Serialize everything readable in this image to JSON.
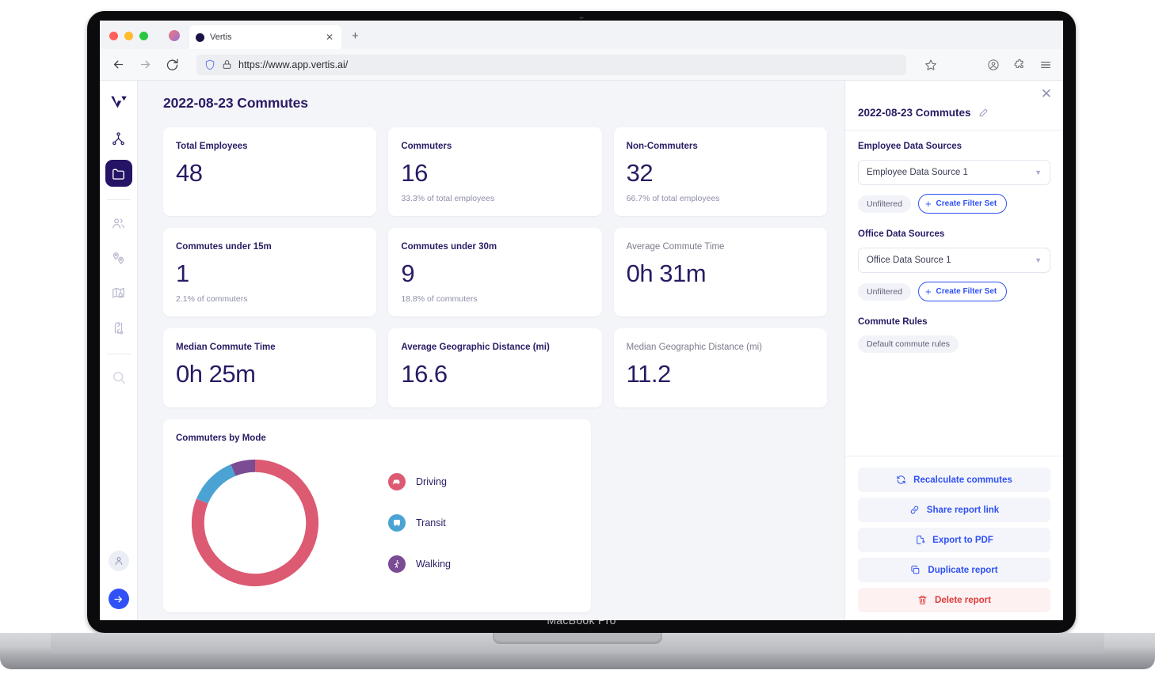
{
  "device": {
    "label": "MacBook Pro"
  },
  "browser": {
    "tab": {
      "title": "Vertis",
      "favicon": "circle-favicon",
      "close_icon": "close-icon"
    },
    "new_tab_icon": "plus-icon",
    "nav": {
      "back_icon": "back-arrow-icon",
      "forward_icon": "forward-arrow-icon",
      "reload_icon": "reload-icon"
    },
    "omnibox": {
      "shield_icon": "shield-icon",
      "lock_icon": "lock-icon",
      "url": "https://www.app.vertis.ai/"
    },
    "actions": {
      "bookmark_icon": "star-icon",
      "account_icon": "account-circle-icon",
      "extensions_icon": "puzzle-icon",
      "menu_icon": "hamburger-menu-icon"
    }
  },
  "sidebar": {
    "logo": "vertis-logo",
    "items": [
      {
        "name": "network",
        "icon": "network-nodes-icon",
        "active": false
      },
      {
        "name": "reports",
        "icon": "folder-icon",
        "active": true
      },
      {
        "name": "people",
        "icon": "people-icon",
        "active": false
      },
      {
        "name": "locations",
        "icon": "location-pins-icon",
        "active": false
      },
      {
        "name": "map-search",
        "icon": "map-search-icon",
        "active": false
      },
      {
        "name": "routes",
        "icon": "route-compare-icon",
        "active": false
      },
      {
        "name": "search",
        "icon": "search-icon",
        "active": false
      }
    ],
    "avatar_icon": "user-avatar-icon",
    "cta_icon": "arrow-right-icon"
  },
  "main": {
    "page_title": "2022-08-23 Commutes",
    "cards": [
      {
        "label": "Total Employees",
        "value": "48",
        "sub": "",
        "muted_label": false
      },
      {
        "label": "Commuters",
        "value": "16",
        "sub": "33.3% of total employees",
        "muted_label": false
      },
      {
        "label": "Non-Commuters",
        "value": "32",
        "sub": "66.7% of total employees",
        "muted_label": false
      },
      {
        "label": "Commutes under 15m",
        "value": "1",
        "sub": "2.1% of commuters",
        "muted_label": false
      },
      {
        "label": "Commutes under 30m",
        "value": "9",
        "sub": "18.8% of commuters",
        "muted_label": false
      },
      {
        "label": "Average Commute Time",
        "value": "0h 31m",
        "sub": "",
        "muted_label": true
      },
      {
        "label": "Median Commute Time",
        "value": "0h 25m",
        "sub": "",
        "muted_label": false
      },
      {
        "label": "Average Geographic Distance (mi)",
        "value": "16.6",
        "sub": "",
        "muted_label": false
      },
      {
        "label": "Median Geographic Distance (mi)",
        "value": "11.2",
        "sub": "",
        "muted_label": true
      }
    ],
    "donut": {
      "title": "Commuters by Mode",
      "legend": [
        {
          "label": "Driving",
          "icon": "car-icon",
          "color": "#DC5A72"
        },
        {
          "label": "Transit",
          "icon": "bus-icon",
          "color": "#4BA3D3"
        },
        {
          "label": "Walking",
          "icon": "walking-person-icon",
          "color": "#7B4B93"
        }
      ]
    }
  },
  "chart_data": {
    "type": "pie",
    "title": "Commuters by Mode",
    "categories": [
      "Driving",
      "Transit",
      "Walking"
    ],
    "values": [
      13,
      2,
      1
    ],
    "percentages": [
      81.25,
      12.5,
      6.25
    ],
    "colors": [
      "#DC5A72",
      "#4BA3D3",
      "#7B4B93"
    ],
    "donut": true,
    "legend_position": "right"
  },
  "panel": {
    "close_icon": "close-icon",
    "title": "2022-08-23 Commutes",
    "edit_icon": "pencil-icon",
    "sections": [
      {
        "label": "Employee Data Sources",
        "select_value": "Employee Data Source 1",
        "caret_icon": "chevron-down-icon",
        "chip": "Unfiltered",
        "filter_button": "Create Filter Set",
        "filter_button_icon": "plus-icon"
      },
      {
        "label": "Office Data Sources",
        "select_value": "Office Data Source 1",
        "caret_icon": "chevron-down-icon",
        "chip": "Unfiltered",
        "filter_button": "Create Filter Set",
        "filter_button_icon": "plus-icon"
      }
    ],
    "rules": {
      "label": "Commute Rules",
      "chip": "Default commute rules"
    },
    "actions": [
      {
        "label": "Recalculate commutes",
        "icon": "refresh-icon",
        "danger": false
      },
      {
        "label": "Share report link",
        "icon": "link-icon",
        "danger": false
      },
      {
        "label": "Export to PDF",
        "icon": "file-export-icon",
        "danger": false
      },
      {
        "label": "Duplicate report",
        "icon": "copy-icon",
        "danger": false
      },
      {
        "label": "Delete report",
        "icon": "trash-icon",
        "danger": true
      }
    ]
  }
}
